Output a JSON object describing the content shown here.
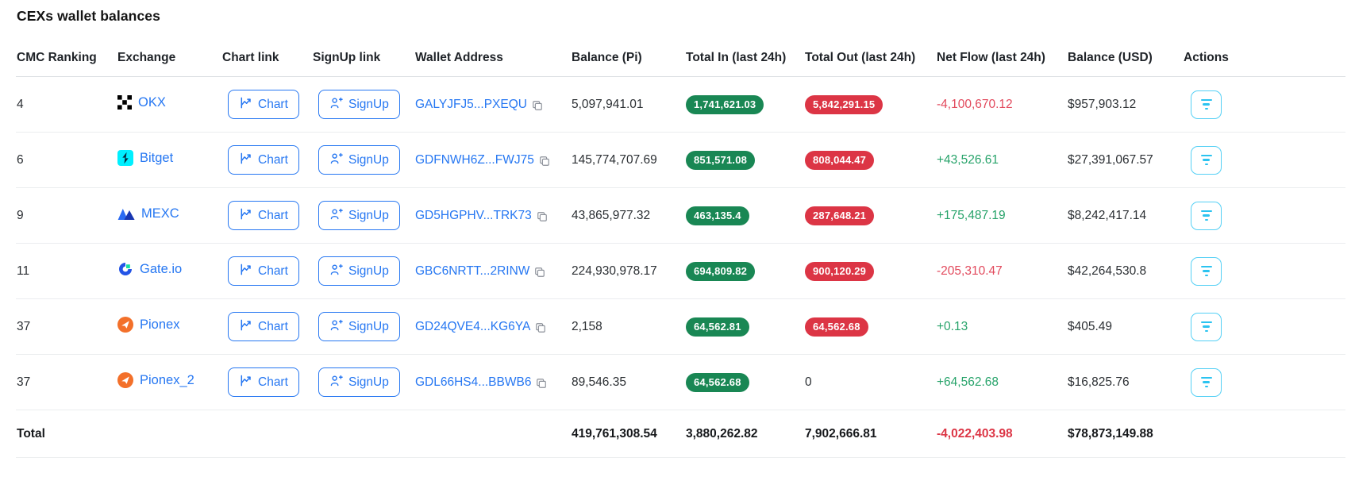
{
  "page": {
    "title": "CEXs wallet balances"
  },
  "buttons": {
    "chart": "Chart",
    "signup": "SignUp"
  },
  "table": {
    "columns": [
      "CMC Ranking",
      "Exchange",
      "Chart link",
      "SignUp link",
      "Wallet Address",
      "Balance (Pi)",
      "Total In (last 24h)",
      "Total Out (last 24h)",
      "Net Flow (last 24h)",
      "Balance (USD)",
      "Actions"
    ],
    "rows": [
      {
        "rank": "4",
        "exchange": "OKX",
        "wallet": "GALYJFJ5...PXEQU",
        "balance_pi": "5,097,941.01",
        "total_in": "1,741,621.03",
        "total_out": "5,842,291.15",
        "net_flow": "-4,100,670.12",
        "balance_usd": "$957,903.12"
      },
      {
        "rank": "6",
        "exchange": "Bitget",
        "wallet": "GDFNWH6Z...FWJ75",
        "balance_pi": "145,774,707.69",
        "total_in": "851,571.08",
        "total_out": "808,044.47",
        "net_flow": "+43,526.61",
        "balance_usd": "$27,391,067.57"
      },
      {
        "rank": "9",
        "exchange": "MEXC",
        "wallet": "GD5HGPHV...TRK73",
        "balance_pi": "43,865,977.32",
        "total_in": "463,135.4",
        "total_out": "287,648.21",
        "net_flow": "+175,487.19",
        "balance_usd": "$8,242,417.14"
      },
      {
        "rank": "11",
        "exchange": "Gate.io",
        "wallet": "GBC6NRTT...2RINW",
        "balance_pi": "224,930,978.17",
        "total_in": "694,809.82",
        "total_out": "900,120.29",
        "net_flow": "-205,310.47",
        "balance_usd": "$42,264,530.8"
      },
      {
        "rank": "37",
        "exchange": "Pionex",
        "wallet": "GD24QVE4...KG6YA",
        "balance_pi": "2,158",
        "total_in": "64,562.81",
        "total_out": "64,562.68",
        "net_flow": "+0.13",
        "balance_usd": "$405.49"
      },
      {
        "rank": "37",
        "exchange": "Pionex_2",
        "wallet": "GDL66HS4...BBWB6",
        "balance_pi": "89,546.35",
        "total_in": "64,562.68",
        "total_out": "0",
        "net_flow": "+64,562.68",
        "balance_usd": "$16,825.76"
      }
    ],
    "total": {
      "label": "Total",
      "balance_pi": "419,761,308.54",
      "total_in": "3,880,262.82",
      "total_out": "7,902,666.81",
      "net_flow": "-4,022,403.98",
      "balance_usd": "$78,873,149.88"
    }
  },
  "colors": {
    "link_blue": "#2677f2",
    "badge_green": "#198754",
    "badge_red": "#dc3545",
    "flow_green": "#27a36a",
    "flow_red": "#e2495c",
    "action_cyan": "#2bc3f0"
  }
}
